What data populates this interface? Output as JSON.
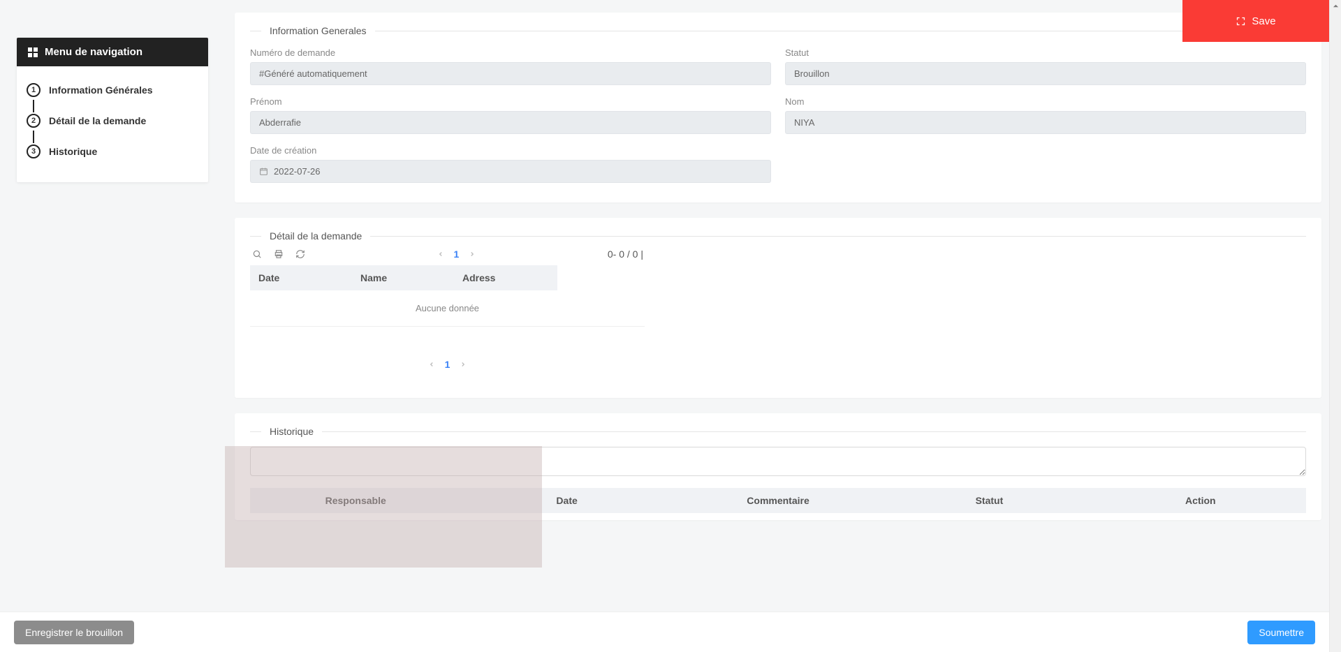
{
  "nav": {
    "title": "Menu de navigation",
    "steps": [
      {
        "num": "1",
        "label": "Information Générales"
      },
      {
        "num": "2",
        "label": "Détail de la demande"
      },
      {
        "num": "3",
        "label": "Historique"
      }
    ]
  },
  "save_fab": {
    "label": "Save"
  },
  "section_general": {
    "legend": "Information Generales",
    "fields": {
      "numero_label": "Numéro de demande",
      "numero_value": "#Généré automatiquement",
      "statut_label": "Statut",
      "statut_value": "Brouillon",
      "prenom_label": "Prénom",
      "prenom_value": "Abderrafie",
      "nom_label": "Nom",
      "nom_value": "NIYA",
      "date_label": "Date de création",
      "date_value": "2022-07-26"
    }
  },
  "section_detail": {
    "legend": "Détail de la demande",
    "pager_page": "1",
    "range_info": "0- 0 / 0 |",
    "columns": {
      "c1": "Date",
      "c2": "Name",
      "c3": "Adress"
    },
    "empty_text": "Aucune donnée"
  },
  "section_historique": {
    "legend": "Historique",
    "columns": {
      "c1": "Responsable",
      "c2": "Date",
      "c3": "Commentaire",
      "c4": "Statut",
      "c5": "Action"
    }
  },
  "footer": {
    "draft": "Enregistrer le brouillon",
    "submit": "Soumettre"
  }
}
